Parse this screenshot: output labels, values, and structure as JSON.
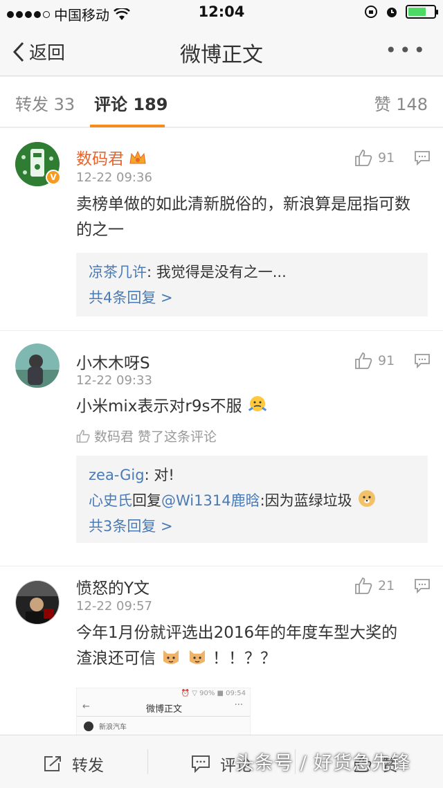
{
  "status_bar": {
    "carrier": "中国移动",
    "time": "12:04"
  },
  "nav": {
    "back_label": "返回",
    "title": "微博正文",
    "more_label": "•••"
  },
  "tabs": {
    "repost": "转发 33",
    "comments": "评论 189",
    "likes": "赞 148"
  },
  "comments": [
    {
      "name": "数码君",
      "time": "12-22 09:36",
      "likes": "91",
      "text": "卖榜单做的如此清新脱俗的，新浪算是屈指可数的之一",
      "replies": [
        {
          "author": "凉茶几许",
          "content": ": 我觉得是没有之一..."
        }
      ],
      "more_replies": "共4条回复 >"
    },
    {
      "name": "小木木呀S",
      "time": "12-22 09:33",
      "likes": "91",
      "text": "小米mix表示对r9s不服",
      "liked_by": "数码君 赞了这条评论",
      "replies": [
        {
          "author": "zea-Gig",
          "content": ": 对!"
        },
        {
          "author": "心史氏",
          "middle": "回复",
          "mention": "@Wi1314鹿晗",
          "content": ":因为蓝绿垃圾"
        }
      ],
      "more_replies": "共3条回复 >"
    },
    {
      "name": "愤怒的Y文",
      "time": "12-22 09:57",
      "likes": "21",
      "text_line1": "今年1月份就评选出2016年的年度车型大奖的",
      "text_line2": "渣浪还可信",
      "text_tail": "！！？？"
    }
  ],
  "embedded_screenshot": {
    "status": "⏰ ▽ 90% ■ 09:54",
    "back": "←",
    "title": "微博正文",
    "more": "···",
    "row": "新浪汽车"
  },
  "toolbar": {
    "repost": "转发",
    "comment": "评论",
    "like": "赞"
  },
  "watermark": "头条号 / 好货急先锋",
  "colors": {
    "accent": "#f78b1f",
    "link_blue": "#4a7ab5",
    "vip_name": "#e8642d"
  }
}
